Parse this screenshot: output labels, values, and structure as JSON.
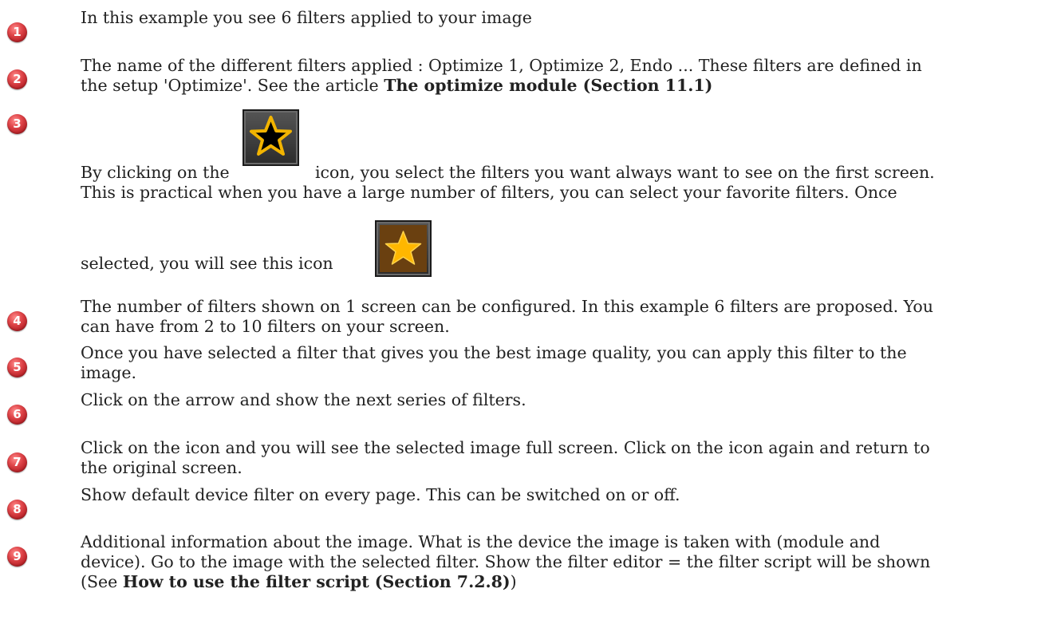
{
  "items": [
    {
      "number": "1",
      "text": "In this example you see 6 filters applied to your image"
    },
    {
      "number": "2",
      "line1": "The name of the different filters applied : Optimize 1, Optimize 2, Endo ... These filters are defined in",
      "line2_pre": "the setup 'Optimize'. See the article ",
      "line2_bold": "The optimize module (Section 11.1)"
    },
    {
      "number": "3",
      "line1_pre": "By clicking on the",
      "line1_post": "icon, you select the filters you want always want to see on the first screen.",
      "line2": "This is practical when you have a large number of filters, you can select your favorite filters. Once",
      "line3": "selected, you will see this icon"
    },
    {
      "number": "4",
      "line1": "The number of filters shown on 1 screen can be configured. In this example 6 filters are proposed. You",
      "line2": "can have from 2 to 10 filters on your screen."
    },
    {
      "number": "5",
      "line1": "Once you have selected a filter that gives you the best image quality, you can apply this filter to the",
      "line2": "image."
    },
    {
      "number": "6",
      "text": "Click on the arrow and show the next series of filters."
    },
    {
      "number": "7",
      "line1": "Click on the icon and you will see the selected image full screen. Click on the icon again and return to",
      "line2": "the original screen."
    },
    {
      "number": "8",
      "text": "Show default device filter on every page.  This can be switched on or off."
    },
    {
      "number": "9",
      "line1": "Additional information about the image. What is the device the image is taken with (module and",
      "line2": "device). Go to the image with the selected filter. Show the filter editor = the filter script will be shown",
      "line3_pre": "(See ",
      "line3_bold": "How to use the filter script (Section 7.2.8)",
      "line3_post": ")"
    }
  ],
  "icons": {
    "unselected": "star-outline-icon",
    "selected": "star-filled-icon"
  }
}
